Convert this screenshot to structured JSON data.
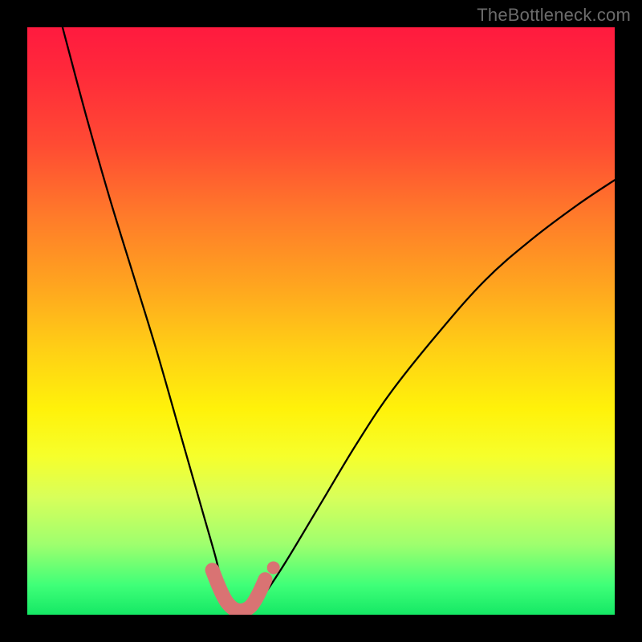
{
  "watermark": "TheBottleneck.com",
  "chart_data": {
    "type": "line",
    "title": "",
    "xlabel": "",
    "ylabel": "",
    "xlim": [
      0,
      100
    ],
    "ylim": [
      0,
      100
    ],
    "grid": false,
    "legend": false,
    "annotations": [],
    "series": [
      {
        "name": "bottleneck-curve",
        "x": [
          6,
          10,
          14,
          18,
          22,
          26,
          28,
          30,
          32,
          33,
          34,
          35,
          36,
          37,
          38,
          40,
          44,
          50,
          56,
          62,
          70,
          78,
          86,
          94,
          100
        ],
        "y": [
          100,
          85,
          71,
          58,
          45,
          31,
          24,
          17,
          10,
          6,
          3,
          1,
          0,
          0,
          1,
          3,
          9,
          19,
          29,
          38,
          48,
          57,
          64,
          70,
          74
        ]
      },
      {
        "name": "highlight-band",
        "x": [
          31.5,
          32.4,
          33.2,
          34.0,
          35.0,
          36.0,
          37.0,
          38.0,
          38.8,
          39.6,
          40.5
        ],
        "y": [
          7.6,
          5.3,
          3.5,
          2.1,
          1.1,
          0.7,
          0.8,
          1.4,
          2.5,
          4.0,
          6.0
        ]
      }
    ],
    "colors": {
      "curve": "#000000",
      "highlight_stroke": "#d97373",
      "highlight_fill": "#d97373",
      "gradient_top": "#ff1a3f",
      "gradient_mid": "#fff20a",
      "gradient_bottom": "#15e865",
      "frame": "#000000",
      "watermark": "#6b6b6b"
    }
  }
}
